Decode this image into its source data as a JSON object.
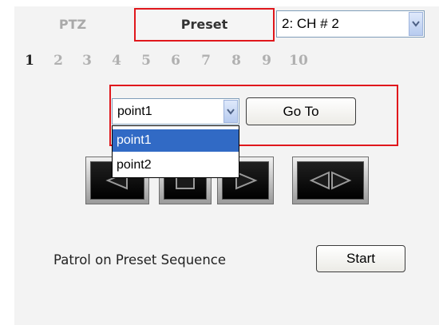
{
  "tabs": {
    "ptz_label": "PTZ",
    "preset_label": "Preset"
  },
  "channel_select": {
    "value": "2: CH # 2"
  },
  "preset_numbers": [
    "1",
    "2",
    "3",
    "4",
    "5",
    "6",
    "7",
    "8",
    "9",
    "10"
  ],
  "active_preset_number": "1",
  "point_select": {
    "value": "point1",
    "options": [
      "point1",
      "point2"
    ],
    "highlighted_option": "point1"
  },
  "goto_label": "Go To",
  "controls": [
    "left-icon",
    "stop-icon",
    "right-icon",
    "left-right-icon"
  ],
  "patrol": {
    "label": "Patrol on Preset Sequence",
    "start_label": "Start"
  },
  "colors": {
    "highlight": "#e0171c",
    "selection": "#316ac5",
    "inactive_text": "#b0b0b0"
  }
}
